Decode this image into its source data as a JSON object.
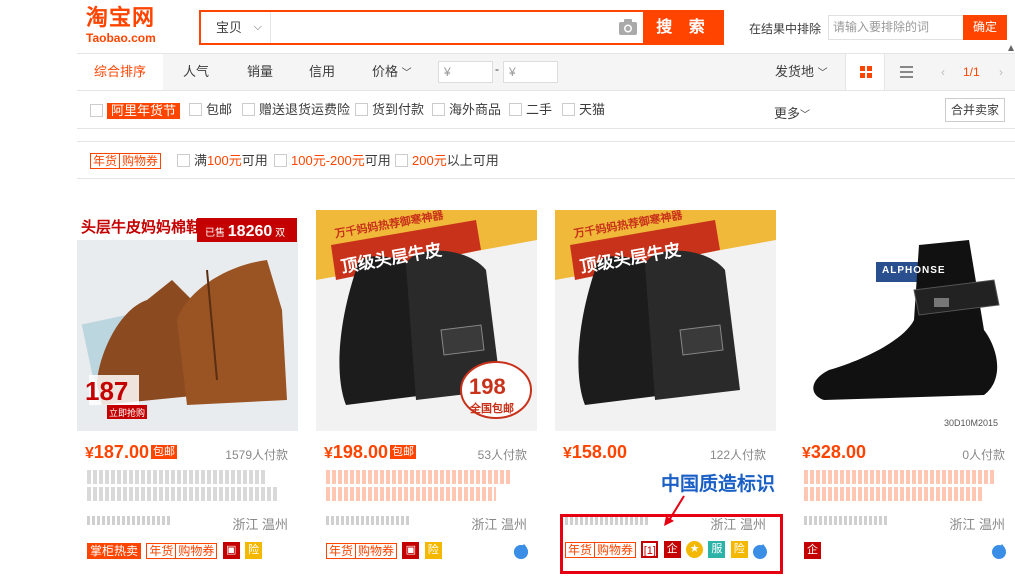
{
  "header": {
    "logo_cn": "淘宝网",
    "logo_en": "Taobao.com",
    "search_category": "宝贝",
    "search_placeholder": "",
    "search_button": "搜 索",
    "exclude_label": "在结果中排除",
    "exclude_placeholder": "请输入要排除的词",
    "confirm_button": "确定"
  },
  "sortbar": {
    "items": [
      "综合排序",
      "人气",
      "销量",
      "信用",
      "价格"
    ],
    "price_from": "¥",
    "price_to": "¥",
    "price_dash": "-",
    "ship_from": "发货地",
    "page": "1/1"
  },
  "filters_row1": [
    "阿里年货节",
    "包邮",
    "赠送退货运费险",
    "货到付款",
    "海外商品",
    "二手",
    "天猫"
  ],
  "more": "更多",
  "merge": "合并卖家",
  "coupon": {
    "tag_a": "年货",
    "tag_b": "购物券",
    "opt1_a": "满",
    "opt1_b": "100元",
    "opt1_c": "可用",
    "opt2_a": "100元-200元",
    "opt2_b": "可用",
    "opt3_a": "200元",
    "opt3_b": "以上可用"
  },
  "products": [
    {
      "price": "187.00",
      "yen": "¥",
      "baoyou": "包邮",
      "deals": "1579人付款",
      "location": "浙江 温州",
      "badge_text": "头层牛皮妈妈棉鞋",
      "badge_count_prefix": "已售",
      "badge_count": "18260",
      "badge_count_unit": "双",
      "img_price": "187",
      "img_price2": "立即抢购"
    },
    {
      "price": "198.00",
      "yen": "¥",
      "baoyou": "包邮",
      "deals": "53人付款",
      "location": "浙江 温州",
      "badge_text": "万千妈妈热荐御寒神器",
      "badge_text2": "顶级头层牛皮",
      "img_price": "198",
      "img_price2": "全国包邮"
    },
    {
      "price": "158.00",
      "yen": "¥",
      "baoyou": "",
      "deals": "122人付款",
      "location": "浙江 温州",
      "badge_text": "万千妈妈热荐御寒神器",
      "badge_text2": "顶级头层牛皮"
    },
    {
      "price": "328.00",
      "yen": "¥",
      "baoyou": "",
      "deals": "0人付款",
      "location": "浙江 温州",
      "brand": "ALPHONSE",
      "sku": "30D10M2015"
    }
  ],
  "icon_labels": {
    "zhanggui": "掌柜热卖",
    "nianhuo": "年货",
    "gouwuquan": "购物券",
    "qi": "企",
    "fu": "服",
    "xian": "险"
  },
  "annotation": "中国质造标识",
  "colors": {
    "accent": "#ff4400",
    "annotation": "#1a5fc5",
    "frame": "#e60012"
  }
}
